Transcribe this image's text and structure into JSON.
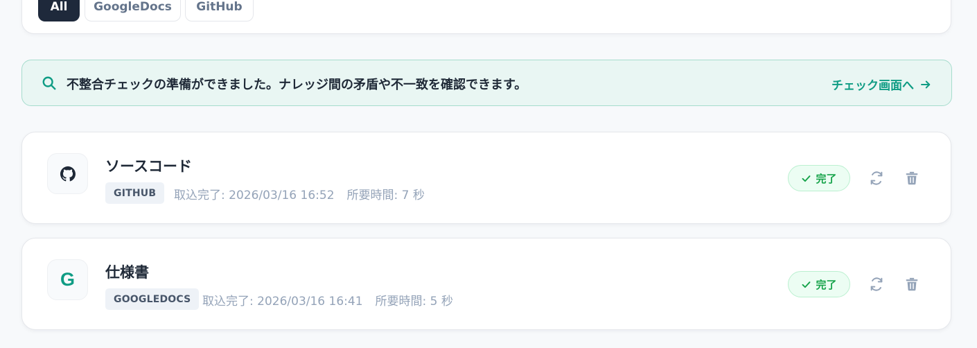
{
  "filters": [
    {
      "label": "All",
      "active": true
    },
    {
      "label": "GoogleDocs",
      "active": false
    },
    {
      "label": "GitHub",
      "active": false
    }
  ],
  "banner": {
    "icon": "search-icon",
    "message": "不整合チェックの準備ができました。ナレッジ間の矛盾や不一致を確認できます。",
    "link_label": "チェック画面へ",
    "link_icon": "arrow-right-icon"
  },
  "sources": [
    {
      "icon": "github-icon",
      "title": "ソースコード",
      "type": "GITHUB",
      "imported": "取込完了: 2026/03/16 16:52",
      "duration": "所要時間: 7 秒",
      "status": "完了"
    },
    {
      "icon": "google-icon",
      "icon_glyph": "G",
      "title": "仕様書",
      "type": "GOOGLEDOCS",
      "imported": "取込完了: 2026/03/16 16:41",
      "duration": "所要時間: 5 秒",
      "status": "完了"
    }
  ],
  "colors": {
    "accent": "#0f9c84",
    "success": "#16a34a",
    "active_filter_bg": "#1e293b",
    "banner_bg": "#e9f6f3"
  }
}
